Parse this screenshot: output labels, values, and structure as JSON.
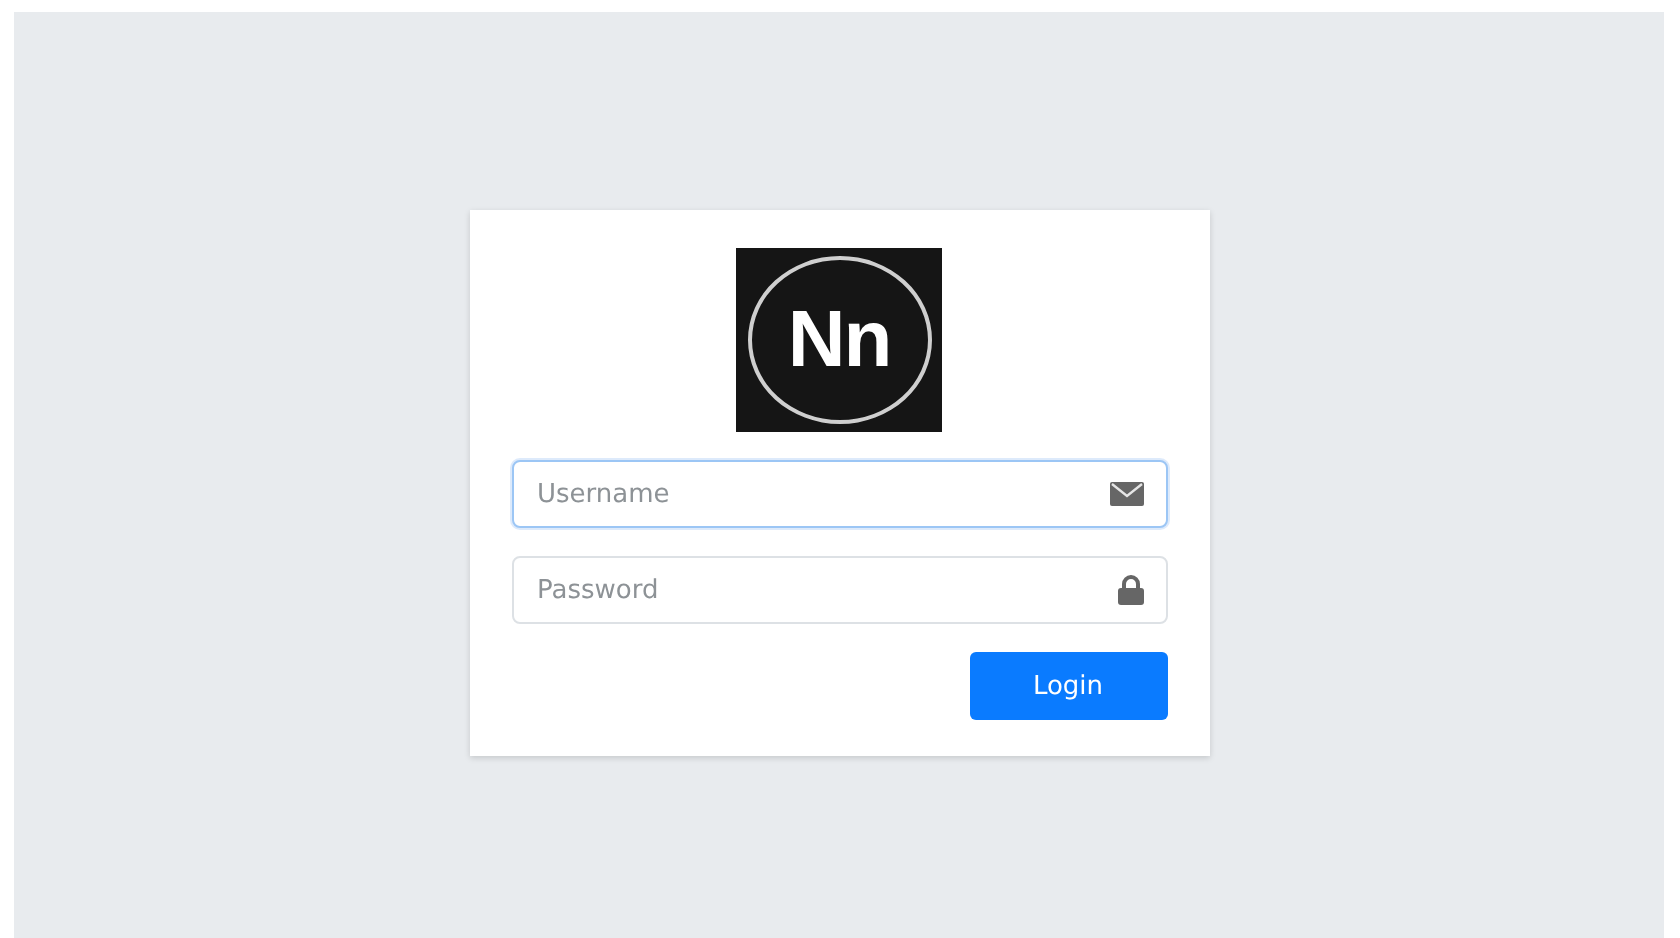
{
  "logo": {
    "text": "Nn"
  },
  "fields": [
    {
      "placeholder": "Username",
      "kind": "email",
      "focused": true
    },
    {
      "placeholder": "Password",
      "kind": "password",
      "focused": false
    }
  ],
  "login_button": {
    "label": "Login"
  }
}
